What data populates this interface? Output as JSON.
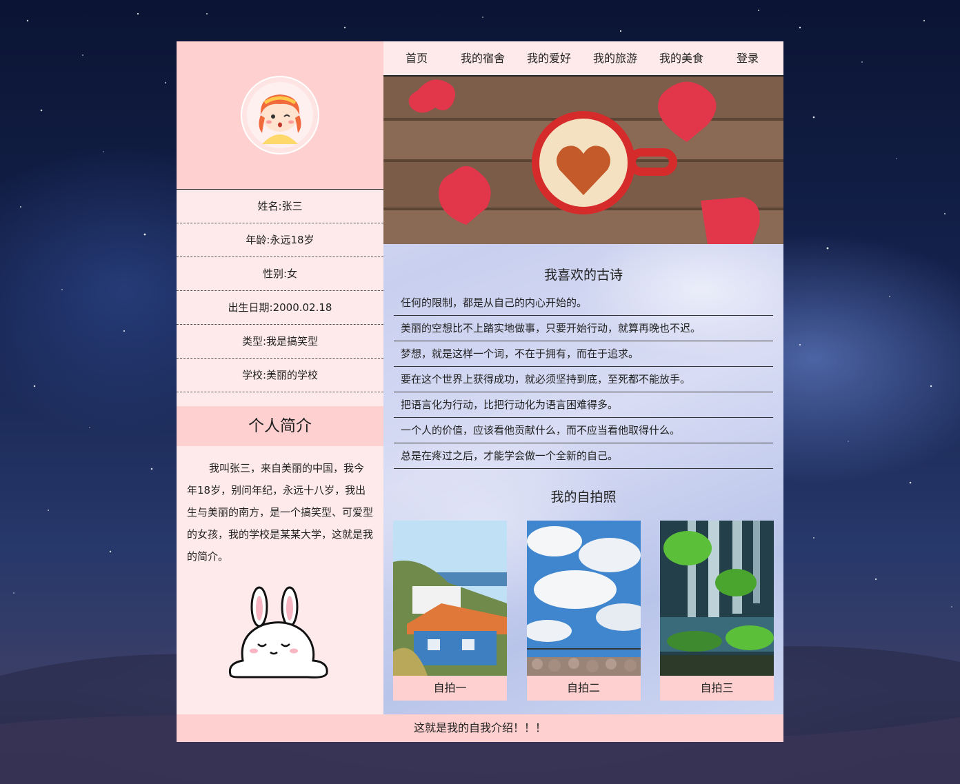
{
  "profile": {
    "rows": [
      "姓名:张三",
      "年龄:永远18岁",
      "性别:女",
      "出生日期:2000.02.18",
      "类型:我是搞笑型",
      "学校:美丽的学校"
    ]
  },
  "intro": {
    "title": "个人简介",
    "text": "我叫张三，来自美丽的中国，我今年18岁，别问年纪，永远十八岁，我出生与美丽的南方，是一个搞笑型、可爱型的女孩，我的学校是某某大学，这就是我的简介。"
  },
  "nav": {
    "items": [
      "首页",
      "我的宿舍",
      "我的爱好",
      "我的旅游",
      "我的美食",
      "登录"
    ]
  },
  "poems": {
    "title": "我喜欢的古诗",
    "lines": [
      "任何的限制，都是从自己的内心开始的。",
      "美丽的空想比不上踏实地做事，只要开始行动，就算再晚也不迟。",
      "梦想，就是这样一个词，不在于拥有，而在于追求。",
      "要在这个世界上获得成功，就必须坚持到底，至死都不能放手。",
      "把语言化为行动，比把行动化为语言困难得多。",
      "一个人的价值，应该看他贡献什么，而不应当看他取得什么。",
      "总是在疼过之后，才能学会做一个全新的自己。"
    ]
  },
  "selfies": {
    "title": "我的自拍照",
    "captions": [
      "自拍一",
      "自拍二",
      "自拍三"
    ]
  },
  "footer": {
    "text": "这就是我的自我介绍！！！"
  },
  "colors": {
    "pink": "#ffd0d0",
    "light_pink": "#ffeaeb",
    "text": "#222222"
  },
  "icons": {
    "avatar": "cartoon-girl-avatar",
    "bunny": "lying-bunny-sticker"
  }
}
